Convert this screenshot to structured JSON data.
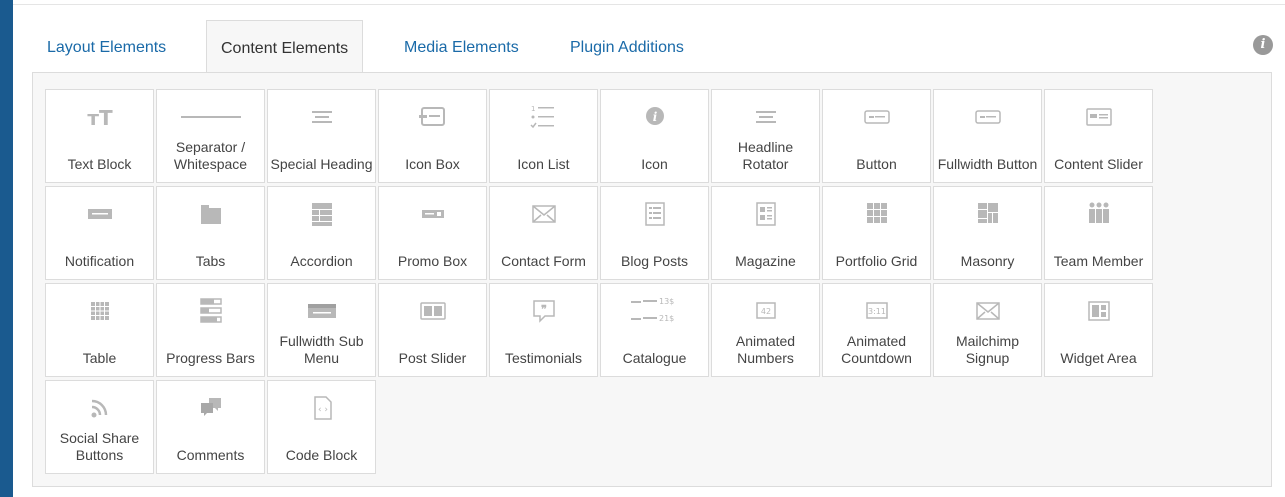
{
  "tabs": [
    {
      "label": "Layout Elements",
      "active": false
    },
    {
      "label": "Content Elements",
      "active": true
    },
    {
      "label": "Media Elements",
      "active": false
    },
    {
      "label": "Plugin Additions",
      "active": false
    }
  ],
  "info_icon": "info-icon",
  "elements": [
    {
      "icon": "text-block-icon",
      "label": "Text Block"
    },
    {
      "icon": "separator-icon",
      "label": "Separator / Whitespace"
    },
    {
      "icon": "special-heading-icon",
      "label": "Special Heading"
    },
    {
      "icon": "icon-box-icon",
      "label": "Icon Box"
    },
    {
      "icon": "icon-list-icon",
      "label": "Icon List"
    },
    {
      "icon": "icon-icon",
      "label": "Icon"
    },
    {
      "icon": "headline-rotator-icon",
      "label": "Headline Rotator"
    },
    {
      "icon": "button-icon",
      "label": "Button"
    },
    {
      "icon": "fullwidth-button-icon",
      "label": "Fullwidth Button"
    },
    {
      "icon": "content-slider-icon",
      "label": "Content Slider"
    },
    {
      "icon": "notification-icon",
      "label": "Notification"
    },
    {
      "icon": "tabs-icon",
      "label": "Tabs"
    },
    {
      "icon": "accordion-icon",
      "label": "Accordion"
    },
    {
      "icon": "promo-box-icon",
      "label": "Promo Box"
    },
    {
      "icon": "contact-form-icon",
      "label": "Contact Form"
    },
    {
      "icon": "blog-posts-icon",
      "label": "Blog Posts"
    },
    {
      "icon": "magazine-icon",
      "label": "Magazine"
    },
    {
      "icon": "portfolio-grid-icon",
      "label": "Portfolio Grid"
    },
    {
      "icon": "masonry-icon",
      "label": "Masonry"
    },
    {
      "icon": "team-member-icon",
      "label": "Team Member"
    },
    {
      "icon": "table-icon",
      "label": "Table"
    },
    {
      "icon": "progress-bars-icon",
      "label": "Progress Bars"
    },
    {
      "icon": "fullwidth-sub-menu-icon",
      "label": "Fullwidth Sub Menu"
    },
    {
      "icon": "post-slider-icon",
      "label": "Post Slider"
    },
    {
      "icon": "testimonials-icon",
      "label": "Testimonials"
    },
    {
      "icon": "catalogue-icon",
      "label": "Catalogue",
      "icon_text": [
        "13$",
        "21$"
      ]
    },
    {
      "icon": "animated-numbers-icon",
      "label": "Animated Numbers",
      "icon_text": "42"
    },
    {
      "icon": "animated-countdown-icon",
      "label": "Animated Countdown",
      "icon_text": "3:11"
    },
    {
      "icon": "mailchimp-signup-icon",
      "label": "Mailchimp Signup"
    },
    {
      "icon": "widget-area-icon",
      "label": "Widget Area"
    },
    {
      "icon": "social-share-icon",
      "label": "Social Share Buttons"
    },
    {
      "icon": "comments-icon",
      "label": "Comments"
    },
    {
      "icon": "code-block-icon",
      "label": "Code Block",
      "icon_text": "‹ ›"
    }
  ]
}
